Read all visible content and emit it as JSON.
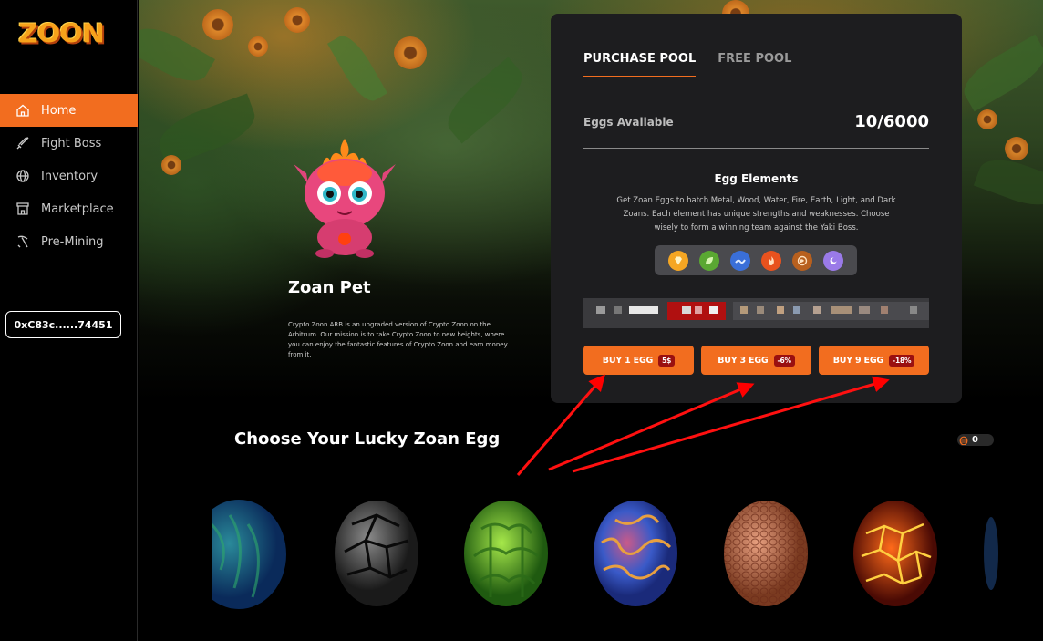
{
  "sidebar": {
    "logo": "ZOON",
    "items": [
      {
        "label": "Home",
        "icon": "home-icon"
      },
      {
        "label": "Fight Boss",
        "icon": "sword-icon"
      },
      {
        "label": "Inventory",
        "icon": "globe-icon"
      },
      {
        "label": "Marketplace",
        "icon": "store-icon"
      },
      {
        "label": "Pre-Mining",
        "icon": "pickaxe-icon"
      }
    ],
    "wallet": "0xC83c......74451"
  },
  "hero": {
    "pet_title": "Zoan Pet",
    "pet_desc": "Crypto Zoon ARB is an upgraded version of Crypto Zoon on the Arbitrum. Our mission is to take Crypto Zoon to new heights, where you can enjoy the fantastic features of Crypto Zoon and earn money from it."
  },
  "panel": {
    "tabs": [
      "PURCHASE POOL",
      "FREE POOL"
    ],
    "avail_label": "Eggs Available",
    "avail_value": "10/6000",
    "elements_title": "Egg Elements",
    "elements_desc": "Get Zoan Eggs to hatch Metal, Wood, Water, Fire, Earth, Light, and Dark Zoans. Each element has unique strengths and weaknesses. Choose wisely to form a winning team against the Yaki Boss.",
    "elements": [
      {
        "name": "metal",
        "color": "#f5a623",
        "icon": "diamond-icon"
      },
      {
        "name": "wood",
        "color": "#5aa832",
        "icon": "leaf-icon"
      },
      {
        "name": "water",
        "color": "#3a6fd8",
        "icon": "wave-icon"
      },
      {
        "name": "fire",
        "color": "#e8521e",
        "icon": "flame-icon"
      },
      {
        "name": "earth",
        "color": "#b8601e",
        "icon": "earth-icon"
      },
      {
        "name": "light",
        "color": "#9a7ae8",
        "icon": "light-icon"
      }
    ],
    "buttons": [
      {
        "label": "BUY 1 EGG",
        "badge": "5$"
      },
      {
        "label": "BUY 3 EGG",
        "badge": "-6%"
      },
      {
        "label": "BUY 9 EGG",
        "badge": "-18%"
      }
    ]
  },
  "eggs": {
    "title": "Choose Your Lucky Zoan Egg",
    "count": "0"
  }
}
